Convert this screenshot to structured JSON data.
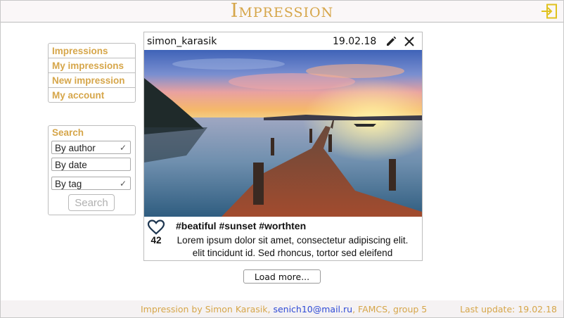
{
  "header": {
    "brand": "Impression",
    "logout_icon": "logout-icon"
  },
  "nav": {
    "items": [
      {
        "label": "Impressions"
      },
      {
        "label": "My impressions"
      },
      {
        "label": "New impression"
      },
      {
        "label": "My account"
      }
    ]
  },
  "search": {
    "title": "Search",
    "filters": [
      {
        "label": "By author",
        "checked": true
      },
      {
        "label": "By date",
        "checked": false
      },
      {
        "label": "By tag",
        "checked": true
      }
    ],
    "check_glyph": "✓",
    "button_label": "Search"
  },
  "post": {
    "author": "simon_karasik",
    "date": "19.02.18",
    "edit_icon": "pencil-icon",
    "close_icon": "close-icon",
    "likes": "42",
    "like_icon": "heart-icon",
    "tags": "#beatiful #sunset #worthten",
    "description_line1": "Lorem ipsum dolor sit amet, consectetur adipiscing elit.",
    "description_line2": "elit tincidunt id. Sed rhoncus, tortor sed eleifend"
  },
  "load_more_label": "Load more...",
  "footer": {
    "credit_prefix": "Impression by Simon Karasik,",
    "email": "senich10@mail.ru",
    "credit_suffix": ", FAMCS, group 5",
    "last_update": "Last update: 19.02.18"
  },
  "colors": {
    "accent": "#d6a64a",
    "link": "#2f4bd6"
  }
}
